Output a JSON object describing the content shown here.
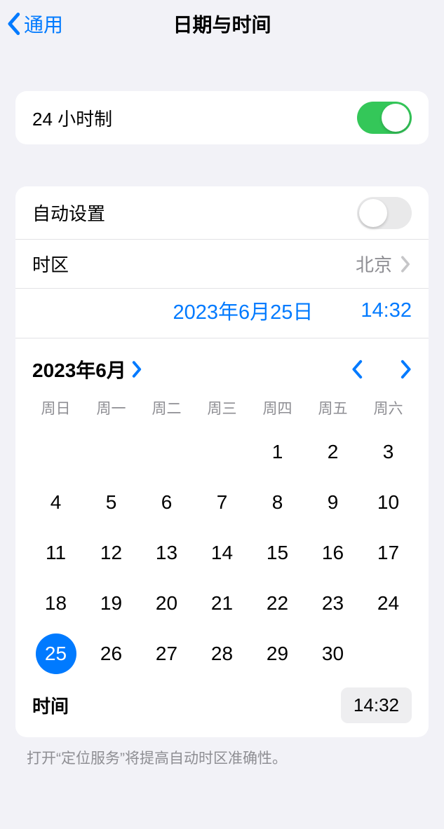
{
  "nav": {
    "back_label": "通用",
    "title": "日期与时间"
  },
  "s1": {
    "label_24h": "24 小时制"
  },
  "s2": {
    "auto_label": "自动设置",
    "tz_label": "时区",
    "tz_value": "北京",
    "date_display": "2023年6月25日",
    "time_display": "14:32",
    "month_label": "2023年6月",
    "dow": [
      "周日",
      "周一",
      "周二",
      "周三",
      "周四",
      "周五",
      "周六"
    ],
    "first_dow": 4,
    "days_in_month": 30,
    "selected_day": 25,
    "time_label": "时间",
    "time_value": "14:32"
  },
  "footer_text": "打开“定位服务”将提高自动时区准确性。"
}
